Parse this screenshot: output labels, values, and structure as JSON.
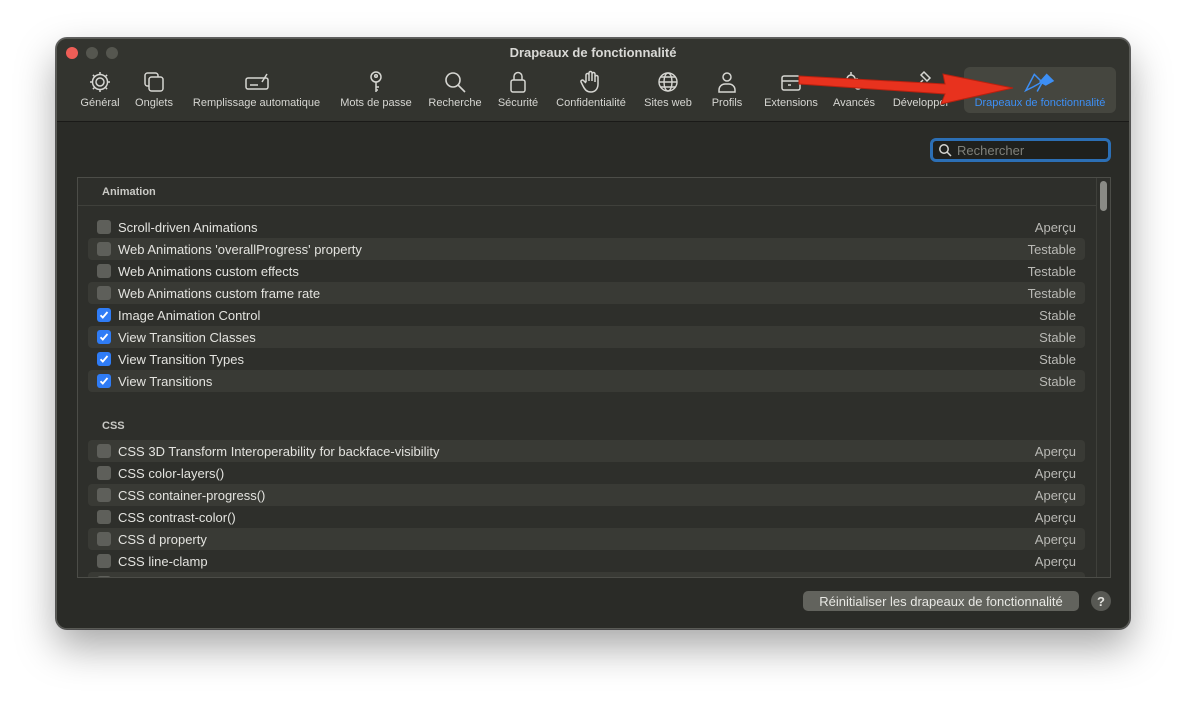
{
  "window": {
    "title": "Drapeaux de fonctionnalité"
  },
  "toolbar": {
    "items": [
      {
        "label": "Général",
        "icon": "gear-icon"
      },
      {
        "label": "Onglets",
        "icon": "tabs-icon"
      },
      {
        "label": "Remplissage automatique",
        "icon": "autofill-icon"
      },
      {
        "label": "Mots de passe",
        "icon": "key-icon"
      },
      {
        "label": "Recherche",
        "icon": "magnifier-icon"
      },
      {
        "label": "Sécurité",
        "icon": "lock-icon"
      },
      {
        "label": "Confidentialité",
        "icon": "hand-icon"
      },
      {
        "label": "Sites web",
        "icon": "globe-icon"
      },
      {
        "label": "Profils",
        "icon": "person-icon"
      },
      {
        "label": "Extensions",
        "icon": "puzzle-icon"
      },
      {
        "label": "Avancés",
        "icon": "gears-icon"
      },
      {
        "label": "Développer",
        "icon": "hammer-icon"
      },
      {
        "label": "Drapeaux de fonctionnalité",
        "icon": "flags-icon",
        "active": true
      }
    ]
  },
  "search": {
    "placeholder": "Rechercher",
    "value": ""
  },
  "sections": [
    {
      "title": "Animation",
      "flags": [
        {
          "name": "Scroll-driven Animations",
          "status": "Aperçu",
          "checked": false
        },
        {
          "name": "Web Animations 'overallProgress' property",
          "status": "Testable",
          "checked": false
        },
        {
          "name": "Web Animations custom effects",
          "status": "Testable",
          "checked": false
        },
        {
          "name": "Web Animations custom frame rate",
          "status": "Testable",
          "checked": false
        },
        {
          "name": "Image Animation Control",
          "status": "Stable",
          "checked": true
        },
        {
          "name": "View Transition Classes",
          "status": "Stable",
          "checked": true
        },
        {
          "name": "View Transition Types",
          "status": "Stable",
          "checked": true
        },
        {
          "name": "View Transitions",
          "status": "Stable",
          "checked": true
        }
      ]
    },
    {
      "title": "CSS",
      "flags": [
        {
          "name": "CSS 3D Transform Interoperability for backface-visibility",
          "status": "Aperçu",
          "checked": false
        },
        {
          "name": "CSS color-layers()",
          "status": "Aperçu",
          "checked": false
        },
        {
          "name": "CSS container-progress()",
          "status": "Aperçu",
          "checked": false
        },
        {
          "name": "CSS contrast-color()",
          "status": "Aperçu",
          "checked": false
        },
        {
          "name": "CSS d property",
          "status": "Aperçu",
          "checked": false
        },
        {
          "name": "CSS line-clamp",
          "status": "Aperçu",
          "checked": false
        }
      ]
    }
  ],
  "footer": {
    "reset_label": "Réinitialiser les drapeaux de fonctionnalité",
    "help_label": "?"
  },
  "colors": {
    "accent": "#3d8ff5",
    "checkbox_checked": "#2f7cf6",
    "annotation_arrow": "#e8321e"
  }
}
